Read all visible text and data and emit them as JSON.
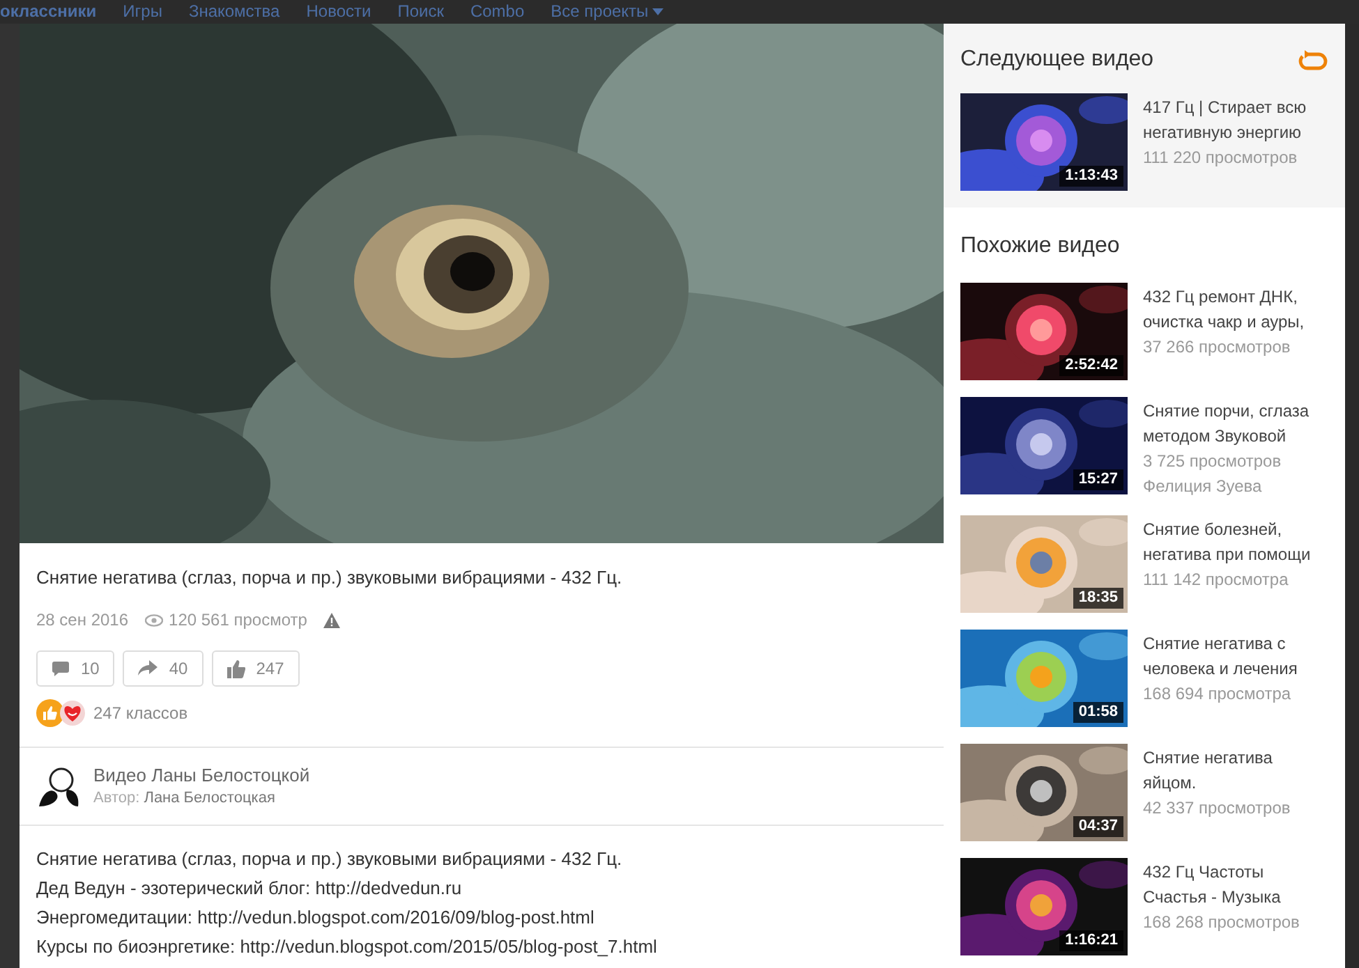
{
  "nav": {
    "items": [
      "оклассники",
      "Игры",
      "Знакомства",
      "Новости",
      "Поиск",
      "Combo",
      "Все проекты"
    ]
  },
  "video": {
    "title": "Снятие негатива (сглаз, порча и пр.) звуковыми вибрациями - 432 Гц.",
    "date": "28 сен 2016",
    "views": "120 561 просмотр",
    "actions": [
      {
        "kind": "comment",
        "count": "10"
      },
      {
        "kind": "share",
        "count": "40"
      },
      {
        "kind": "like",
        "count": "247"
      }
    ],
    "likes": "247 классов"
  },
  "channel": {
    "name": "Видео Ланы Белостоцкой",
    "author_label": "Автор:",
    "author": "Лана Белостоцкая"
  },
  "description": [
    {
      "text": "Снятие негатива (сглаз, порча и пр.) звуковыми вибрациями - 432 Гц."
    },
    {
      "text": "Дед Ведун - эзотерический блог: ",
      "link": "http://dedvedun.ru"
    },
    {
      "text": "Энергомедитации: ",
      "link": "http://vedun.blogspot.com/2016/09/blog-post.html"
    },
    {
      "text": "Курсы по биоэнргетике: ",
      "link": "http://vedun.blogspot.com/2015/05/blog-post_7.html"
    }
  ],
  "next": {
    "heading": "Следующее видео",
    "item": {
      "title_lines": [
        "417 Гц | Стирает всю",
        "негативную энергию"
      ],
      "views": "111 220 просмотров",
      "duration": "1:13:43"
    }
  },
  "similar": {
    "heading": "Похожие видео",
    "items": [
      {
        "title_lines": [
          "432 Гц ремонт ДНК,",
          "очистка чакр и ауры,"
        ],
        "views": "37 266 просмотров",
        "duration": "2:52:42"
      },
      {
        "title_lines": [
          "Снятие порчи, сглаза",
          "методом Звуковой"
        ],
        "views": "3 725 просмотров",
        "author": "Фелиция Зуева",
        "duration": "15:27"
      },
      {
        "title_lines": [
          "Снятие болезней,",
          "негатива при помощи"
        ],
        "views": "111 142 просмотра",
        "duration": "18:35"
      },
      {
        "title_lines": [
          "Снятие негатива с",
          "человека и лечения"
        ],
        "views": "168 694 просмотра",
        "duration": "01:58"
      },
      {
        "title_lines": [
          "Снятие негатива",
          "яйцом."
        ],
        "views": "42 337 просмотров",
        "duration": "04:37"
      },
      {
        "title_lines": [
          "432 Гц Частоты",
          "Счастья - Музыка"
        ],
        "views": "168 268 просмотров",
        "duration": "1:16:21"
      }
    ]
  }
}
